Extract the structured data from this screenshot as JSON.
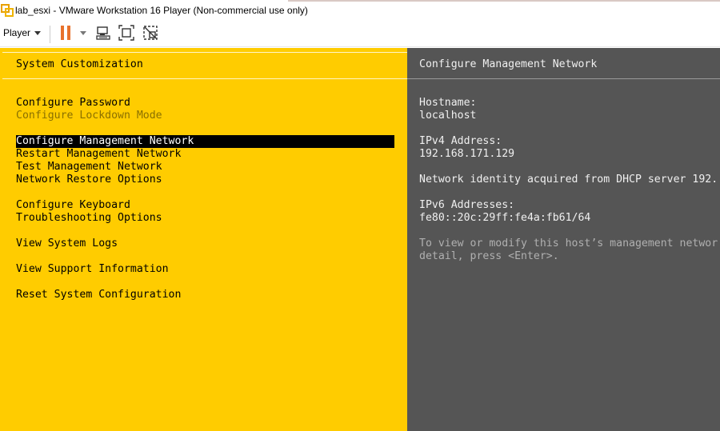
{
  "window": {
    "title": "lab_esxi - VMware Workstation 16 Player (Non-commercial use only)"
  },
  "toolbar": {
    "player_label": "Player"
  },
  "left_pane": {
    "title": "System Customization",
    "items": [
      {
        "label": "Configure Password",
        "state": "normal"
      },
      {
        "label": "Configure Lockdown Mode",
        "state": "disabled"
      },
      {
        "label": "Configure Management Network",
        "state": "selected"
      },
      {
        "label": "Restart Management Network",
        "state": "normal"
      },
      {
        "label": "Test Management Network",
        "state": "normal"
      },
      {
        "label": "Network Restore Options",
        "state": "normal"
      },
      {
        "label": "Configure Keyboard",
        "state": "normal"
      },
      {
        "label": "Troubleshooting Options",
        "state": "normal"
      },
      {
        "label": "View System Logs",
        "state": "normal"
      },
      {
        "label": "View Support Information",
        "state": "normal"
      },
      {
        "label": "Reset System Configuration",
        "state": "normal"
      }
    ]
  },
  "right_pane": {
    "title": "Configure Management Network",
    "hostname_label": "Hostname:",
    "hostname_value": "localhost",
    "ipv4_label": "IPv4 Address:",
    "ipv4_value": "192.168.171.129",
    "network_identity": "Network identity acquired from DHCP server 192.",
    "ipv6_label": "IPv6 Addresses:",
    "ipv6_value": "fe80::20c:29ff:fe4a:fb61/64",
    "hint_line1": "To view or modify this host’s management networ",
    "hint_line2": "detail, press <Enter>."
  },
  "colors": {
    "dcui_yellow": "#ffcc00",
    "dcui_gray": "#555555",
    "pause_orange": "#e8722c"
  },
  "icons": [
    "vmware-app-icon",
    "pause-icon",
    "send-ctrl-alt-del-icon",
    "fit-guest-icon",
    "unity-mode-icon"
  ]
}
